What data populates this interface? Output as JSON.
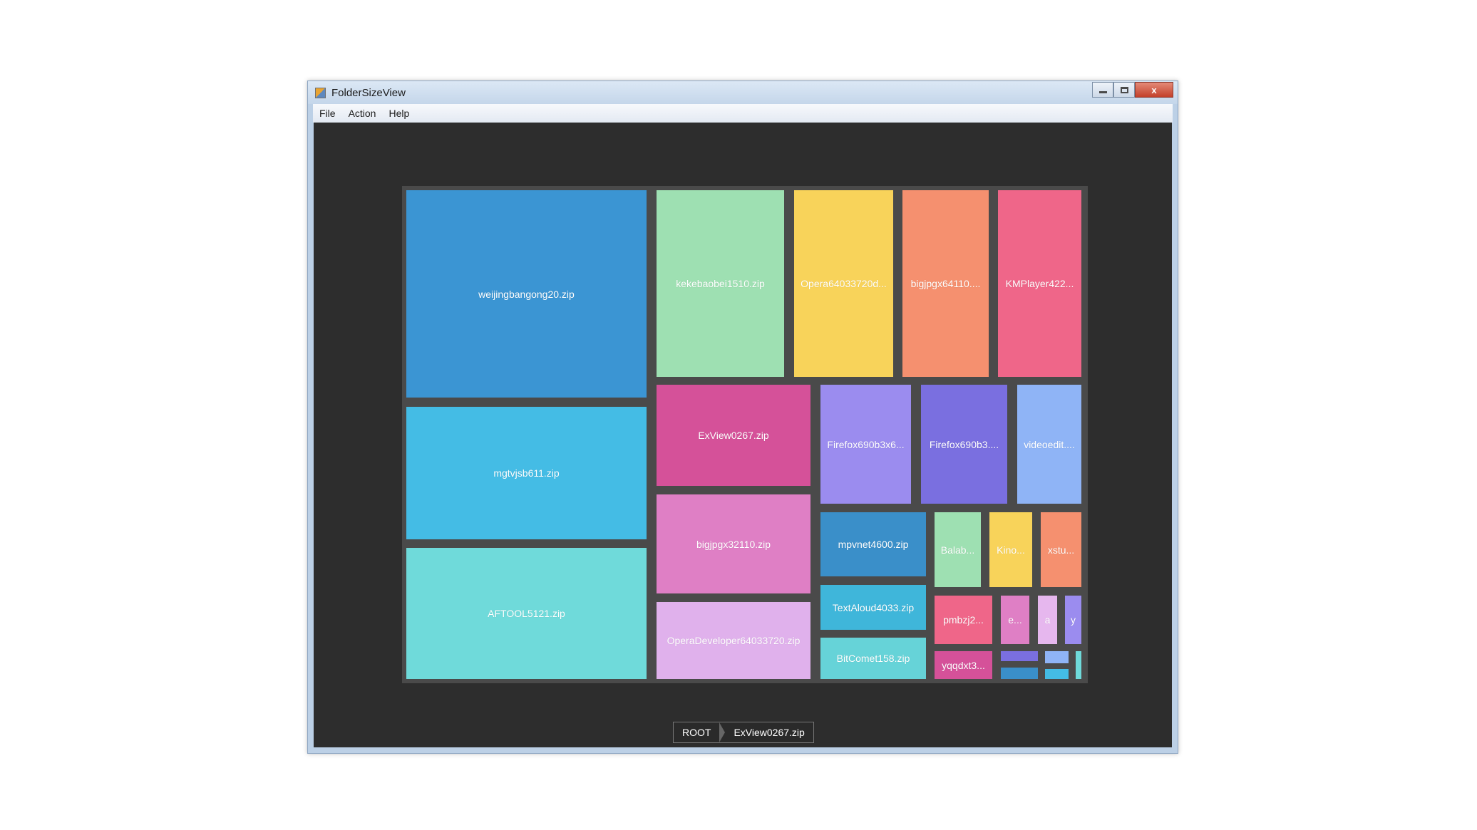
{
  "window": {
    "title": "FolderSizeView",
    "icon": "app-icon",
    "controls": {
      "minimize": "minimize-icon",
      "maximize": "maximize-icon",
      "close": "x"
    }
  },
  "menu": [
    "File",
    "Action",
    "Help"
  ],
  "treemap": {
    "tiles": [
      {
        "label": "weijingbangong20.zip",
        "color": "#3b95d3"
      },
      {
        "label": "mgtvjsb611.zip",
        "color": "#44bce5"
      },
      {
        "label": "AFTOOL5121.zip",
        "color": "#6fdada"
      },
      {
        "label": "kekebaobei1510.zip",
        "color": "#9ee0b2"
      },
      {
        "label": "Opera64033720d...",
        "color": "#f8d35a"
      },
      {
        "label": "bigjpgx64110....",
        "color": "#f5906f"
      },
      {
        "label": "KMPlayer422...",
        "color": "#ef6689"
      },
      {
        "label": "ExView0267.zip",
        "color": "#d55199"
      },
      {
        "label": "Firefox690b3x6...",
        "color": "#9b8cef"
      },
      {
        "label": "Firefox690b3....",
        "color": "#7a6fe0"
      },
      {
        "label": "videoedit....",
        "color": "#8fb4f6"
      },
      {
        "label": "bigjpgx32110.zip",
        "color": "#df7fc5"
      },
      {
        "label": "OperaDeveloper64033720.zip",
        "color": "#e0b1ec"
      },
      {
        "label": "mpvnet4600.zip",
        "color": "#3a8fc9"
      },
      {
        "label": "TextAloud4033.zip",
        "color": "#3fb6da"
      },
      {
        "label": "BitComet158.zip",
        "color": "#66d3d8"
      },
      {
        "label": "Balab...",
        "color": "#9ee0b2"
      },
      {
        "label": "Kino...",
        "color": "#f8d35a"
      },
      {
        "label": "xstu...",
        "color": "#f5906f"
      },
      {
        "label": "pmbzj2...",
        "color": "#ef6689"
      },
      {
        "label": "e...",
        "color": "#df7fc5"
      },
      {
        "label": "a",
        "color": "#e6b7ee"
      },
      {
        "label": "y",
        "color": "#9b8cef"
      },
      {
        "label": "yqqdxt3...",
        "color": "#d55199"
      },
      {
        "label": "",
        "color": "#7a6fe0"
      },
      {
        "label": "",
        "color": "#3a8fc9"
      },
      {
        "label": "",
        "color": "#8fb4f6"
      },
      {
        "label": "",
        "color": "#44bce5"
      },
      {
        "label": "",
        "color": "#6fdada"
      }
    ]
  },
  "breadcrumb": [
    "ROOT",
    "ExView0267.zip"
  ]
}
